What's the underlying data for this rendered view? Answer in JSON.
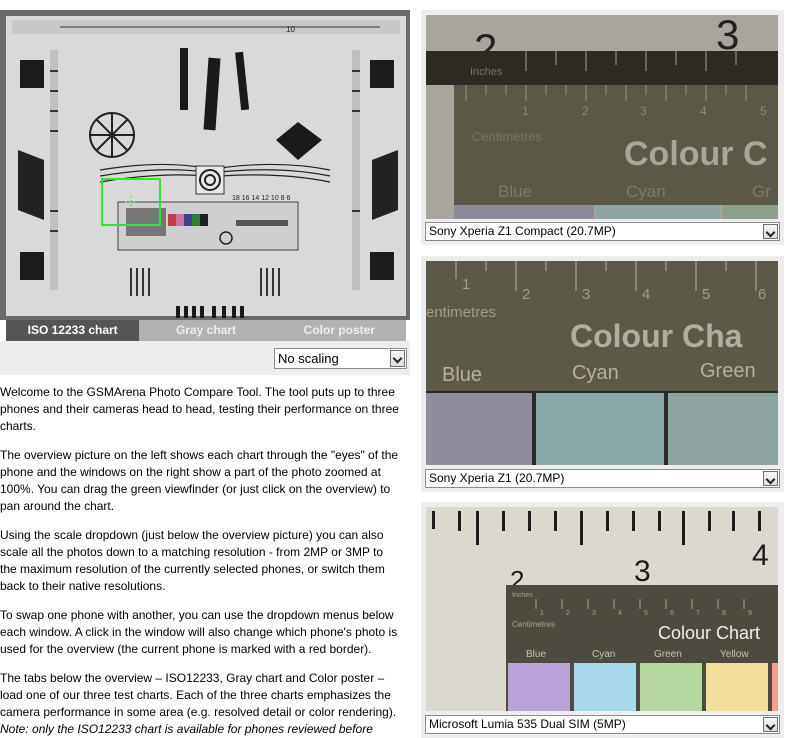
{
  "overview": {
    "tabs": [
      {
        "label": "ISO 12233 chart",
        "active": true
      },
      {
        "label": "Gray chart",
        "active": false
      },
      {
        "label": "Color poster",
        "active": false
      }
    ],
    "scale_select": "No scaling",
    "chart_labels": {
      "top_tick": "10",
      "mid_ticks": "18  16  14  12  10  8  6"
    },
    "viewfinder_color": "#2ee62e"
  },
  "intro": {
    "paragraphs": [
      "Welcome to the GSMArena Photo Compare Tool. The tool puts up to three phones and their cameras head to head, testing their performance on three charts.",
      "The overview picture on the left shows each chart through the \"eyes\" of the phone and the windows on the right show a part of the photo zoomed at 100%. You can drag the green viewfinder (or just click on the overview) to pan around the chart.",
      "Using the scale dropdown (just below the overview picture) you can also scale all the photos down to a matching resolution - from 2MP or 3MP to the maximum resolution of the currently selected phones, or switch them back to their native resolutions.",
      "To swap one phone with another, you can use the dropdown menus below each window. A click in the window will also change which phone's photo is used for the overview (the current phone is marked with a red border).",
      "The tabs below the overview – ISO12233, Gray chart and Color poster – load one of our three test charts. Each of the three charts emphasizes the camera performance in some area (e.g. resolved detail or color rendering)."
    ],
    "note": "Note: only the ISO12233 chart is available for phones reviewed before"
  },
  "panels": [
    {
      "phone": "Sony Xperia Z1 Compact (20.7MP)",
      "big_digits": [
        "2",
        "3"
      ],
      "ruler_unit_top": "Inches",
      "ruler_unit": "Centimetres",
      "ruler_numbers": [
        "1",
        "2",
        "3",
        "4",
        "5"
      ],
      "title": "Colour C",
      "swatch_labels": [
        "Blue",
        "Cyan",
        "Gr"
      ]
    },
    {
      "phone": "Sony Xperia Z1 (20.7MP)",
      "ruler_unit": "entimetres",
      "ruler_numbers": [
        "1",
        "2",
        "3",
        "4",
        "5",
        "6"
      ],
      "title": "Colour Cha",
      "swatch_labels": [
        "Blue",
        "Cyan",
        "Green"
      ]
    },
    {
      "phone": "Microsoft Lumia 535 Dual SIM (5MP)",
      "big_digits": [
        "3",
        "4",
        "2"
      ],
      "ruler_unit_top": "Inches",
      "ruler_unit": "Centimetres",
      "ruler_numbers": [
        "1",
        "2",
        "3",
        "4",
        "5",
        "6",
        "7",
        "8",
        "9"
      ],
      "title": "Colour Chart",
      "swatch_labels": [
        "Blue",
        "Cyan",
        "Green",
        "Yellow"
      ]
    }
  ]
}
